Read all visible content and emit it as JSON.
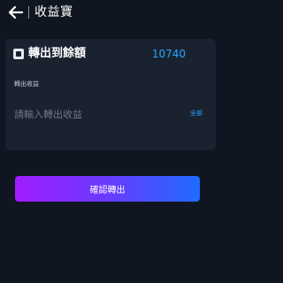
{
  "header": {
    "title": "收益寶",
    "back_icon": "arrow-left-icon"
  },
  "card": {
    "icon": "wallet-icon",
    "amount_label": "轉出到餘額",
    "amount_value": "10740",
    "sub_label": "轉出收益",
    "input_placeholder": "請輸入轉出收益",
    "all_label": "全部"
  },
  "actions": {
    "confirm_label": "確認轉出"
  },
  "colors": {
    "background": "#0f1621",
    "card": "#1a2230",
    "accent": "#25a7ff",
    "button_gradient_start": "#a01cff",
    "button_gradient_end": "#1f6bff"
  }
}
